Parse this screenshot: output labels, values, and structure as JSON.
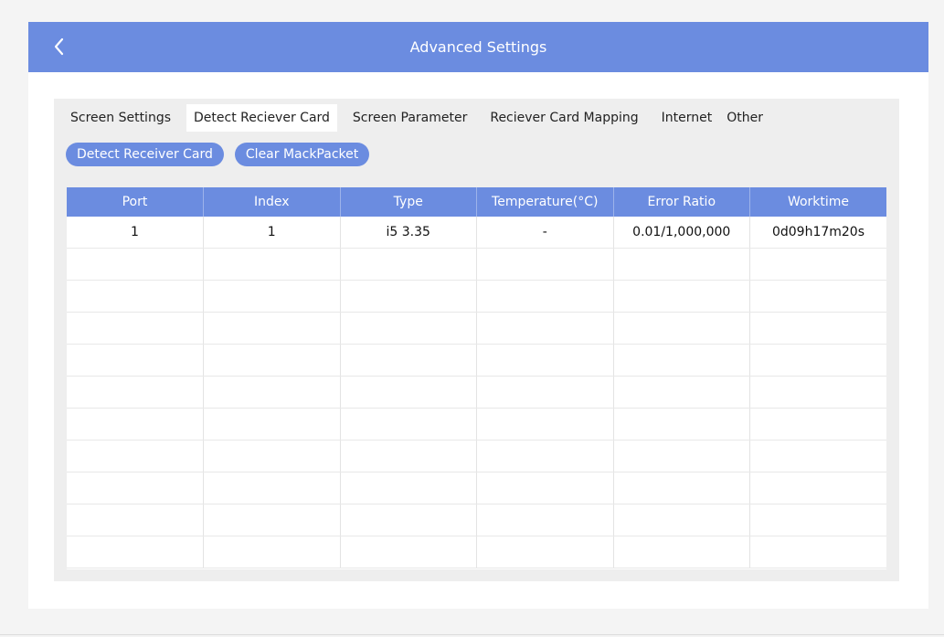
{
  "header": {
    "title": "Advanced Settings",
    "back_icon": "chevron-left-icon"
  },
  "tabs": [
    {
      "label": "Screen Settings",
      "active": false
    },
    {
      "label": "Detect Reciever Card",
      "active": true
    },
    {
      "label": "Screen Parameter",
      "active": false
    },
    {
      "label": "Reciever Card Mapping",
      "active": false
    },
    {
      "label": "Internet",
      "active": false
    },
    {
      "label": "Other",
      "active": false
    }
  ],
  "actions": {
    "detect_label": "Detect Receiver Card",
    "clear_label": "Clear MackPacket"
  },
  "table": {
    "columns": [
      "Port",
      "Index",
      "Type",
      "Temperature(°C)",
      "Error Ratio",
      "Worktime"
    ],
    "rows": [
      [
        "1",
        "1",
        "i5 3.35",
        "-",
        "0.01/1,000,000",
        "0d09h17m20s"
      ]
    ],
    "empty_row_count": 10
  },
  "colors": {
    "accent": "#6b8ce0",
    "panel": "#eeeeee",
    "background": "#f4f4f4"
  }
}
